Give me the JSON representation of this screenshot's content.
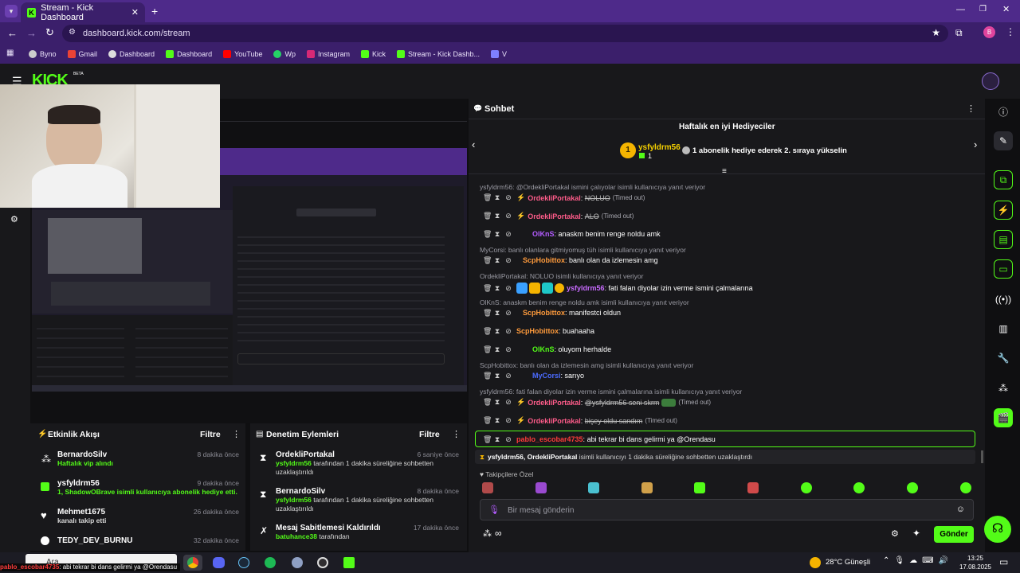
{
  "browser": {
    "tab_title": "Stream - Kick Dashboard",
    "url": "dashboard.kick.com/stream",
    "profile_initial": "B",
    "bookmarks": [
      "Byno",
      "Gmail",
      "Dashboard",
      "Dashboard",
      "YouTube",
      "Wp",
      "Instagram",
      "Kick",
      "Stream - Kick Dashb...",
      "V"
    ]
  },
  "header": {
    "logo": "KICK",
    "beta": "BETA"
  },
  "chat": {
    "title": "Sohbet",
    "gifters_title": "Haftalık en iyi Hediyeciler",
    "top_gifter": {
      "name": "ysfyldrm56",
      "count": "1",
      "rank": "1"
    },
    "gift_prompt": "1 abonelik hediye ederek 2. sıraya yükselin",
    "lines": [
      {
        "type": "reply",
        "text": "ysfyldrm56: @OrdekliPortakal ismini çalıyolar isimli kullanıcıya yanıt veriyor"
      },
      {
        "type": "msg",
        "user": "OrdekliPortakal",
        "color": "#ff5c8a",
        "text": "NOLUO",
        "strike": true,
        "timeout": "(Timed out)"
      },
      {
        "type": "msg",
        "user": "OrdekliPortakal",
        "color": "#ff5c8a",
        "text": "ALO",
        "strike": true,
        "timeout": "(Timed out)"
      },
      {
        "type": "msg",
        "user": "OlKnS",
        "color": "#b35cff",
        "text": "anaskm benim renge noldu amk"
      },
      {
        "type": "reply",
        "text": "MyCorsi: banlı olanlara gitmiyomuş tüh isimli kullanıcıya yanıt veriyor"
      },
      {
        "type": "msg",
        "user": "ScpHobittox",
        "color": "#ff9b3c",
        "text": "banlı olan da izlemesin amg"
      },
      {
        "type": "reply",
        "text": "OrdekliPortakal: NOLUO isimli kullanıcıya yanıt veriyor"
      },
      {
        "type": "msg",
        "user": "ysfyldrm56",
        "color": "#c86bff",
        "text": "fati falan diyolar izin verme ismini çalmalarına"
      },
      {
        "type": "reply",
        "text": "OlKnS: anaskm benim renge noldu amk isimli kullanıcıya yanıt veriyor"
      },
      {
        "type": "msg",
        "user": "ScpHobittox",
        "color": "#ff9b3c",
        "text": "manifestci oldun"
      },
      {
        "type": "msg",
        "user": "ScpHobittox",
        "color": "#ff9b3c",
        "text": "buahaaha"
      },
      {
        "type": "msg",
        "user": "OlKnS",
        "color": "#53fc18",
        "text": "oluyom herhalde"
      },
      {
        "type": "reply",
        "text": "ScpHobittox: banlı olan da izlemesin amg isimli kullanıcıya yanıt veriyor"
      },
      {
        "type": "msg",
        "user": "MyCorsi",
        "color": "#4b6bff",
        "text": "sarıyo"
      },
      {
        "type": "reply",
        "text": "ysfyldrm56: fati falan diyolar izin verme ismini çalmalarına isimli kullanıcıya yanıt veriyor"
      },
      {
        "type": "msg",
        "user": "OrdekliPortakal",
        "color": "#ff5c8a",
        "text": "@ysfyldrm56 seni skrm",
        "strike": true,
        "timeout": "(Timed out)"
      },
      {
        "type": "msg",
        "user": "OrdekliPortakal",
        "color": "#ff5c8a",
        "text": "bişey oldu sandım",
        "strike": true,
        "timeout": "(Timed out)"
      },
      {
        "type": "msg",
        "user": "pablo_escobar4735",
        "color": "#ff3b3b",
        "text": "abi tekrar bi dans gelirmi ya @Orendasu",
        "highlight": true
      }
    ],
    "notice_users": "ysfyldrm56, OrdekliPortakal",
    "notice_text": "isimli kullanıcıyı 1 dakika süreliğine sohbetten uzaklaştırdı",
    "emote_label": "Takipçilere Özel",
    "input_placeholder": "Bir mesaj gönderin",
    "send_label": "Gönder"
  },
  "activity": {
    "title": "Etkinlik Akışı",
    "filter": "Filtre",
    "items": [
      {
        "name": "BernardoSilv",
        "sub": "Haftalık vip alındı",
        "time": "8 dakika önce"
      },
      {
        "name": "ysfyldrm56",
        "sub": "1, ShadowOBrave isimli kullanıcıya abonelik hediye etti.",
        "time": "9 dakika önce"
      },
      {
        "name": "Mehmet1675",
        "sub": "kanalı takip etti",
        "time": "26 dakika önce"
      },
      {
        "name": "TEDY_DEV_BURNU",
        "sub": "",
        "time": "32 dakika önce"
      }
    ]
  },
  "moderation": {
    "title": "Denetim Eylemleri",
    "filter": "Filtre",
    "items": [
      {
        "name": "OrdekliPortakal",
        "sub_user": "ysfyldrm56",
        "sub": "tarafından 1 dakika süreliğine sohbetten uzaklaştırıldı",
        "time": "6 saniye önce"
      },
      {
        "name": "BernardoSilv",
        "sub_user": "ysfyldrm56",
        "sub": "tarafından 1 dakika süreliğine sohbetten uzaklaştırıldı",
        "time": "8 dakika önce"
      },
      {
        "name": "Mesaj Sabitlemesi Kaldırıldı",
        "sub_user": "batuhance38",
        "sub": "tarafından",
        "time": "17 dakika önce"
      }
    ]
  },
  "taskbar": {
    "search": "Ara",
    "overlay_user": "pablo_escobar4735",
    "overlay_text": "abi tekrar bi dans gelirmi ya @Orendasu",
    "weather": "28°C  Güneşli",
    "time": "13:25",
    "date": "17.08.2025"
  },
  "colors": {
    "kick_green": "#53fc18",
    "bg": "#0f0f11",
    "panel": "#18181b",
    "browser": "#3b1f6b"
  }
}
